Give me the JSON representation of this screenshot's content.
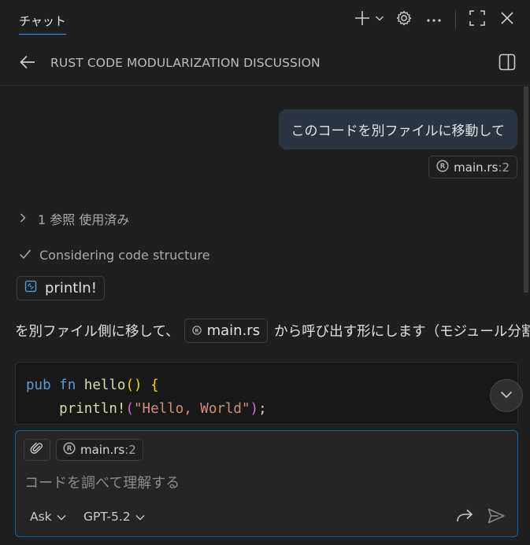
{
  "top_tab": {
    "label": "チャット"
  },
  "header": {
    "title": "RUST CODE MODULARIZATION DISCUSSION"
  },
  "conversation": {
    "user_message": "このコードを別ファイルに移動して",
    "user_reference": {
      "name": "main.rs",
      "line": ":2"
    },
    "references_summary": "1 参照 使用済み",
    "thinking_status": "Considering code structure",
    "symbol_chip": "println!",
    "paragraph": {
      "before": "を別ファイル側に移して、",
      "file": "main.rs",
      "after": "から呼び出す形にします（モジュール分割）。"
    },
    "code": {
      "line1": {
        "kw": "pub",
        "kw2": "fn",
        "name": "hello",
        "parens": "()",
        "brace": "{"
      },
      "line2": {
        "indent": "    ",
        "macro": "println!",
        "open": "(",
        "string": "\"Hello, World\"",
        "close": ")",
        "semi": ";"
      }
    }
  },
  "input": {
    "attachment": {
      "name": "main.rs",
      "line": ":2"
    },
    "placeholder": "コードを調べて理解する",
    "mode": "Ask",
    "model": "GPT-5.2"
  },
  "icons": {
    "new_chat": "plus-icon",
    "settings": "gear-icon",
    "more": "ellipsis-icon",
    "maximize": "maximize-icon",
    "close": "close-icon",
    "back": "arrow-left-icon",
    "panel": "panel-toggle-icon",
    "rust": "rust-file-icon",
    "symbol": "symbol-method-icon",
    "attach": "paperclip-icon",
    "delegate": "forward-arrow-icon",
    "send": "send-icon"
  }
}
